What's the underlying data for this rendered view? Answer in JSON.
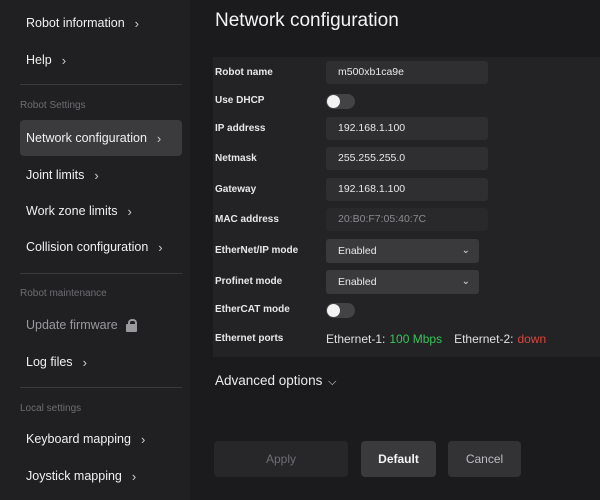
{
  "sidebar": {
    "items_top": [
      {
        "label": "Robot information"
      },
      {
        "label": "Help"
      }
    ],
    "robot_settings_label": "Robot Settings",
    "robot_settings": [
      {
        "label": "Network configuration",
        "active": true
      },
      {
        "label": "Joint limits"
      },
      {
        "label": "Work zone limits"
      },
      {
        "label": "Collision configuration"
      }
    ],
    "robot_maintenance_label": "Robot maintenance",
    "robot_maintenance": [
      {
        "label": "Update firmware",
        "locked": true
      },
      {
        "label": "Log files"
      }
    ],
    "local_settings_label": "Local settings",
    "local_settings": [
      {
        "label": "Keyboard mapping"
      },
      {
        "label": "Joystick mapping"
      }
    ]
  },
  "main": {
    "title": "Network configuration",
    "fields": {
      "robot_name": {
        "label": "Robot name",
        "value": "m500xb1ca9e"
      },
      "use_dhcp": {
        "label": "Use DHCP",
        "on": false
      },
      "ip_address": {
        "label": "IP address",
        "value": "192.168.1.100"
      },
      "netmask": {
        "label": "Netmask",
        "value": "255.255.255.0"
      },
      "gateway": {
        "label": "Gateway",
        "value": "192.168.1.100"
      },
      "mac_address": {
        "label": "MAC address",
        "value": "20:B0:F7:05:40:7C"
      },
      "ethernet_ip_mode": {
        "label": "EtherNet/IP mode",
        "value": "Enabled"
      },
      "profinet_mode": {
        "label": "Profinet mode",
        "value": "Enabled"
      },
      "ethercat_mode": {
        "label": "EtherCAT mode",
        "on": false
      },
      "ethernet_ports": {
        "label": "Ethernet ports",
        "port1_name": "Ethernet-1:",
        "port1_status": "100 Mbps",
        "port2_name": "Ethernet-2:",
        "port2_status": "down"
      }
    },
    "advanced_label": "Advanced options",
    "buttons": {
      "apply": "Apply",
      "default": "Default",
      "cancel": "Cancel"
    }
  },
  "colors": {
    "port_up": "#3ac25a",
    "port_down": "#e0453a",
    "active_nav": "#3b3b3e"
  }
}
